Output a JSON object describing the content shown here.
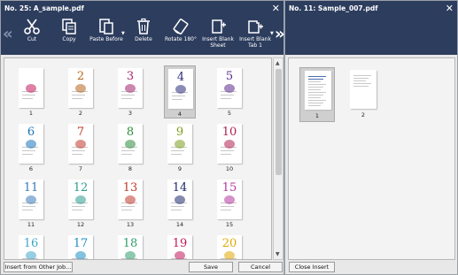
{
  "left_panel": {
    "title": "No. 25: A_sample.pdf",
    "close_glyph": "✕",
    "nav_prev": "«",
    "nav_next": "»",
    "toolbar": [
      {
        "id": "cut",
        "icon": "scissors-icon",
        "label": "Cut"
      },
      {
        "id": "copy",
        "icon": "copy-icon",
        "label": "Copy"
      },
      {
        "id": "paste-before",
        "icon": "paste-icon",
        "label": "Paste Before",
        "dropdown": true
      },
      {
        "id": "delete",
        "icon": "trash-icon",
        "label": "Delete"
      },
      {
        "id": "rotate",
        "icon": "rotate-icon",
        "label": "Rotate 180°"
      },
      {
        "id": "insert-blank-sheet",
        "icon": "insert-sheet-icon",
        "label": "Insert Blank\nSheet"
      },
      {
        "id": "insert-blank-tab",
        "icon": "insert-tab-icon",
        "label": "Insert Blank\nTab 1",
        "dropdown": true
      }
    ],
    "pages": [
      {
        "num": "1",
        "digit": "",
        "color": "#c2185b"
      },
      {
        "num": "2",
        "digit": "2",
        "color": "#b5651d"
      },
      {
        "num": "3",
        "digit": "3",
        "color": "#a1246b"
      },
      {
        "num": "4",
        "digit": "4",
        "color": "#2b2d7a",
        "selected": true
      },
      {
        "num": "5",
        "digit": "5",
        "color": "#5a2a8a"
      },
      {
        "num": "6",
        "digit": "6",
        "color": "#1a74b8"
      },
      {
        "num": "7",
        "digit": "7",
        "color": "#c0392b"
      },
      {
        "num": "8",
        "digit": "8",
        "color": "#2e8b3a"
      },
      {
        "num": "9",
        "digit": "9",
        "color": "#7a9e1e"
      },
      {
        "num": "10",
        "digit": "10",
        "color": "#b02050"
      },
      {
        "num": "11",
        "digit": "11",
        "color": "#3a7ab8"
      },
      {
        "num": "12",
        "digit": "12",
        "color": "#2a9d8f"
      },
      {
        "num": "13",
        "digit": "13",
        "color": "#c0392b"
      },
      {
        "num": "14",
        "digit": "14",
        "color": "#1e2a6e"
      },
      {
        "num": "15",
        "digit": "15",
        "color": "#b2369e"
      },
      {
        "num": "",
        "digit": "16",
        "color": "#3fa7c9"
      },
      {
        "num": "",
        "digit": "17",
        "color": "#1e8fc2"
      },
      {
        "num": "",
        "digit": "18",
        "color": "#2f9e6a"
      },
      {
        "num": "",
        "digit": "19",
        "color": "#c2185b"
      },
      {
        "num": "",
        "digit": "20",
        "color": "#e0a800"
      }
    ],
    "buttons": {
      "insert_from_other": "Insert from Other Job...",
      "save": "Save",
      "cancel": "Cancel"
    }
  },
  "right_panel": {
    "title": "No. 11: Sample_007.pdf",
    "close_glyph": "✕",
    "pages": [
      {
        "num": "1",
        "selected": true
      },
      {
        "num": "2"
      }
    ],
    "buttons": {
      "close_insert": "Close Insert"
    }
  },
  "colors": {
    "titlebar": "#2d3d5e",
    "panel_bg": "#e8e8e8",
    "selected_thumb": "#cfcfcf"
  }
}
